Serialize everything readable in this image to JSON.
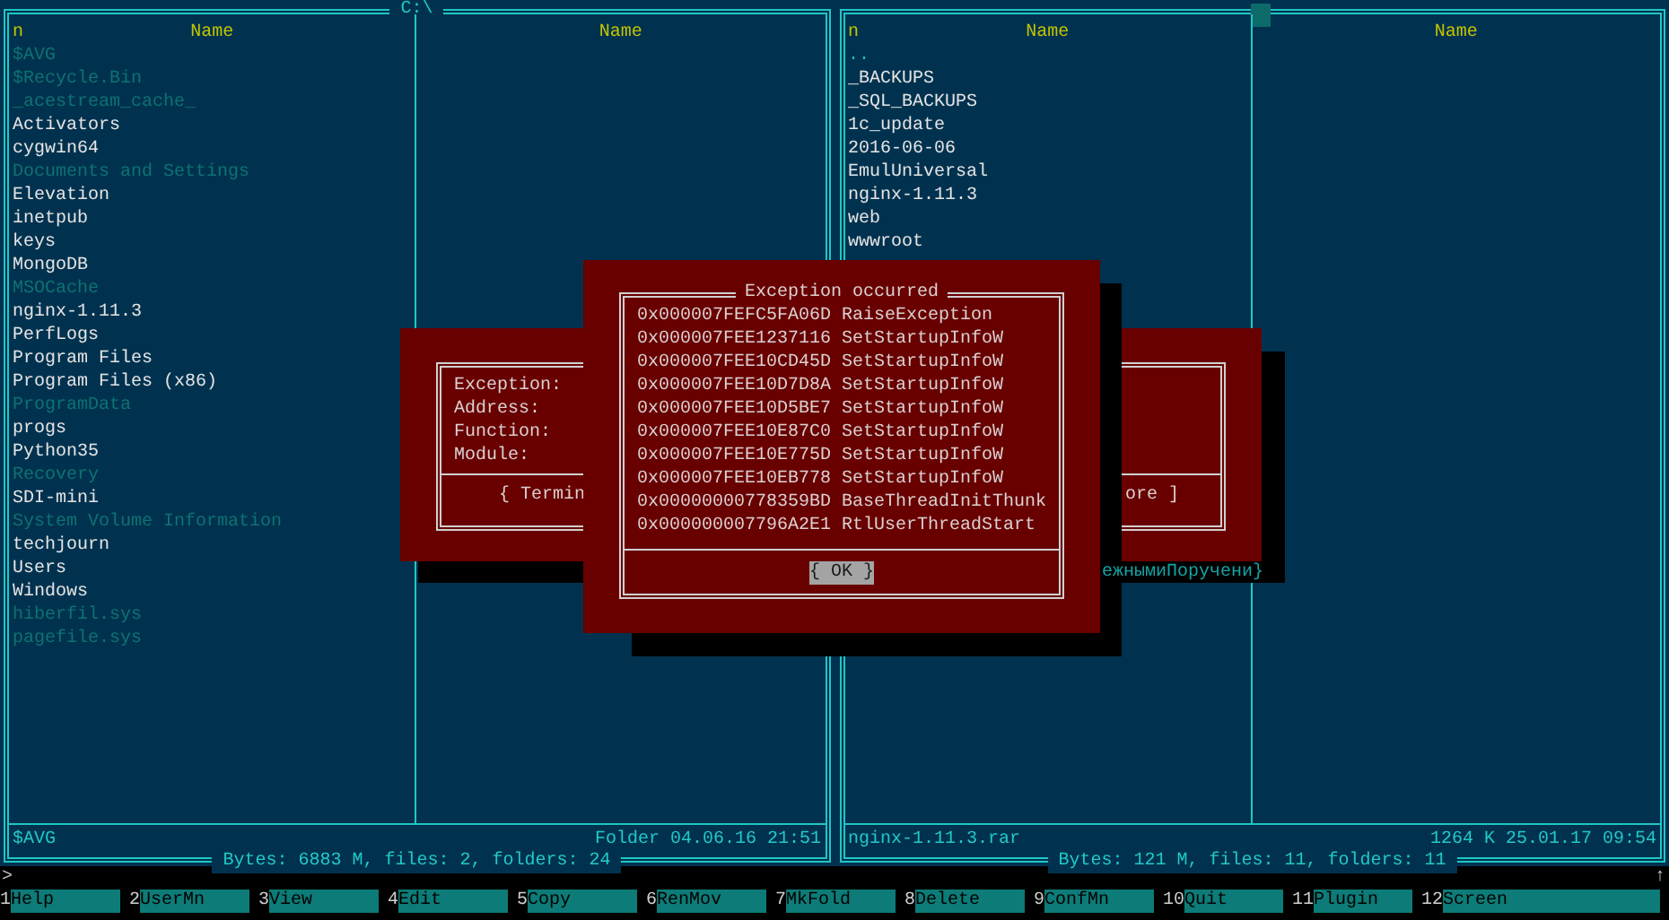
{
  "panels": [
    {
      "title": "C:\\",
      "marker": false,
      "columns": [
        {
          "sort_mark": "n",
          "heading": "Name",
          "files": [
            {
              "name": "$AVG",
              "kind": "hidden"
            },
            {
              "name": "$Recycle.Bin",
              "kind": "hidden"
            },
            {
              "name": "_acestream_cache_",
              "kind": "hidden"
            },
            {
              "name": "Activators",
              "kind": "normal"
            },
            {
              "name": "cygwin64",
              "kind": "normal"
            },
            {
              "name": "Documents and Settings",
              "kind": "hidden"
            },
            {
              "name": "Elevation",
              "kind": "normal"
            },
            {
              "name": "inetpub",
              "kind": "normal"
            },
            {
              "name": "keys",
              "kind": "normal"
            },
            {
              "name": "MongoDB",
              "kind": "normal"
            },
            {
              "name": "MSOCache",
              "kind": "hidden"
            },
            {
              "name": "nginx-1.11.3",
              "kind": "normal"
            },
            {
              "name": "PerfLogs",
              "kind": "normal"
            },
            {
              "name": "Program Files",
              "kind": "normal"
            },
            {
              "name": "Program Files (x86)",
              "kind": "normal"
            },
            {
              "name": "ProgramData",
              "kind": "hidden"
            },
            {
              "name": "progs",
              "kind": "normal"
            },
            {
              "name": "Python35",
              "kind": "normal"
            },
            {
              "name": "Recovery",
              "kind": "hidden"
            },
            {
              "name": "SDI-mini",
              "kind": "normal"
            },
            {
              "name": "System Volume Information",
              "kind": "hidden"
            },
            {
              "name": "techjourn",
              "kind": "normal"
            },
            {
              "name": "Users",
              "kind": "normal"
            },
            {
              "name": "Windows",
              "kind": "normal"
            },
            {
              "name": "hiberfil.sys",
              "kind": "hidden"
            },
            {
              "name": "pagefile.sys",
              "kind": "hidden"
            }
          ]
        },
        {
          "heading": "Name"
        }
      ],
      "status": {
        "name": "$AVG",
        "info": "Folder 04.06.16 21:51"
      },
      "totals": "Bytes: 6883 M, files: 2, folders: 24"
    },
    {
      "marker": true,
      "columns": [
        {
          "sort_mark": "n",
          "heading": "Name",
          "files": [
            {
              "name": "..",
              "kind": "up"
            },
            {
              "name": "_BACKUPS",
              "kind": "normal"
            },
            {
              "name": "_SQL_BACKUPS",
              "kind": "normal"
            },
            {
              "name": "1c_update",
              "kind": "normal"
            },
            {
              "name": "2016-06-06",
              "kind": "normal"
            },
            {
              "name": "EmulUniversal",
              "kind": "normal"
            },
            {
              "name": "nginx-1.11.3",
              "kind": "normal"
            },
            {
              "name": "web",
              "kind": "normal"
            },
            {
              "name": "wwwroot",
              "kind": "normal"
            }
          ]
        },
        {
          "heading": "Name"
        }
      ],
      "status": {
        "name": "nginx-1.11.3.rar",
        "info": "1264 K 25.01.17 09:54"
      },
      "totals": "Bytes: 121 M, files: 11, folders: 11"
    }
  ],
  "error_dialog": {
    "labels": [
      "Exception:",
      "Address:",
      "Function:",
      "Module:"
    ],
    "button_fragments": [
      "{ Termin",
      "ore ]"
    ]
  },
  "overlap_text": "ежнымиПоручени}",
  "exception_dialog": {
    "title": "Exception occurred",
    "frames": [
      {
        "address": "0x000007FEFC5FA06D",
        "function": "RaiseException"
      },
      {
        "address": "0x000007FEE1237116",
        "function": "SetStartupInfoW"
      },
      {
        "address": "0x000007FEE10CD45D",
        "function": "SetStartupInfoW"
      },
      {
        "address": "0x000007FEE10D7D8A",
        "function": "SetStartupInfoW"
      },
      {
        "address": "0x000007FEE10D5BE7",
        "function": "SetStartupInfoW"
      },
      {
        "address": "0x000007FEE10E87C0",
        "function": "SetStartupInfoW"
      },
      {
        "address": "0x000007FEE10E775D",
        "function": "SetStartupInfoW"
      },
      {
        "address": "0x000007FEE10EB778",
        "function": "SetStartupInfoW"
      },
      {
        "address": "0x00000000778359BD",
        "function": "BaseThreadInitThunk"
      },
      {
        "address": "0x000000007796A2E1",
        "function": "RtlUserThreadStart"
      }
    ],
    "button": {
      "label": "{ OK }",
      "selected": true
    }
  },
  "command_line": {
    "prompt": ">",
    "indicator": "↑"
  },
  "keybar": [
    {
      "key": "1",
      "label": "Help"
    },
    {
      "key": "2",
      "label": "UserMn"
    },
    {
      "key": "3",
      "label": "View"
    },
    {
      "key": "4",
      "label": "Edit"
    },
    {
      "key": "5",
      "label": "Copy"
    },
    {
      "key": "6",
      "label": "RenMov"
    },
    {
      "key": "7",
      "label": "MkFold"
    },
    {
      "key": "8",
      "label": "Delete"
    },
    {
      "key": "9",
      "label": "ConfMn"
    },
    {
      "key": "10",
      "label": "Quit"
    },
    {
      "key": "11",
      "label": "Plugin"
    },
    {
      "key": "12",
      "label": "Screen"
    }
  ]
}
